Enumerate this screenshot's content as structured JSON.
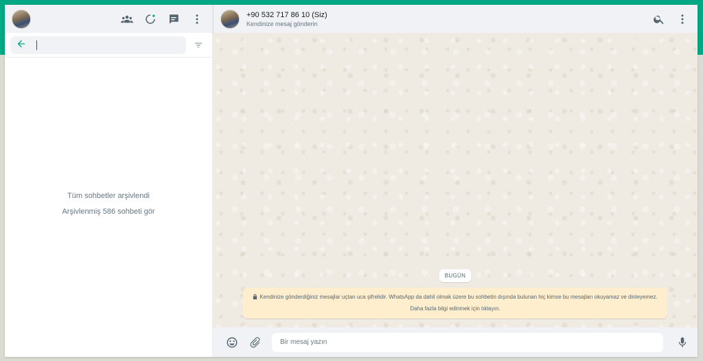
{
  "colors": {
    "accent": "#00a884",
    "panel": "#f0f2f5",
    "chat_bg": "#efeae2",
    "notice_bg": "#ffeecd",
    "icon": "#54656f"
  },
  "sidebar": {
    "header_icons": [
      "communities-icon",
      "status-icon",
      "new-chat-icon",
      "menu-icon"
    ],
    "search": {
      "back_icon": "arrow-left-icon",
      "value": "",
      "filter_icon": "filter-icon"
    },
    "archive": {
      "message": "Tüm sohbetler arşivlendi",
      "link": "Arşivlenmiş 586 sohbeti gör"
    }
  },
  "chat": {
    "header": {
      "name": "+90 532 717 86 10 (Siz)",
      "subtitle": "Kendinize mesaj gönderin",
      "icons": [
        "search-icon",
        "menu-icon"
      ]
    },
    "date_chip": "BUGÜN",
    "encryption_notice": "Kendinize gönderdiğiniz mesajlar uçtan uca şifrelidir. WhatsApp da dahil olmak üzere bu sohbetin dışında bulunan hiç kimse bu mesajları okuyamaz ve dinleyemez. Daha fazla bilgi edinmek için tıklayın.",
    "composer": {
      "placeholder": "Bir mesaj yazın",
      "icons": [
        "emoji-icon",
        "attach-icon",
        "microphone-icon"
      ]
    }
  }
}
